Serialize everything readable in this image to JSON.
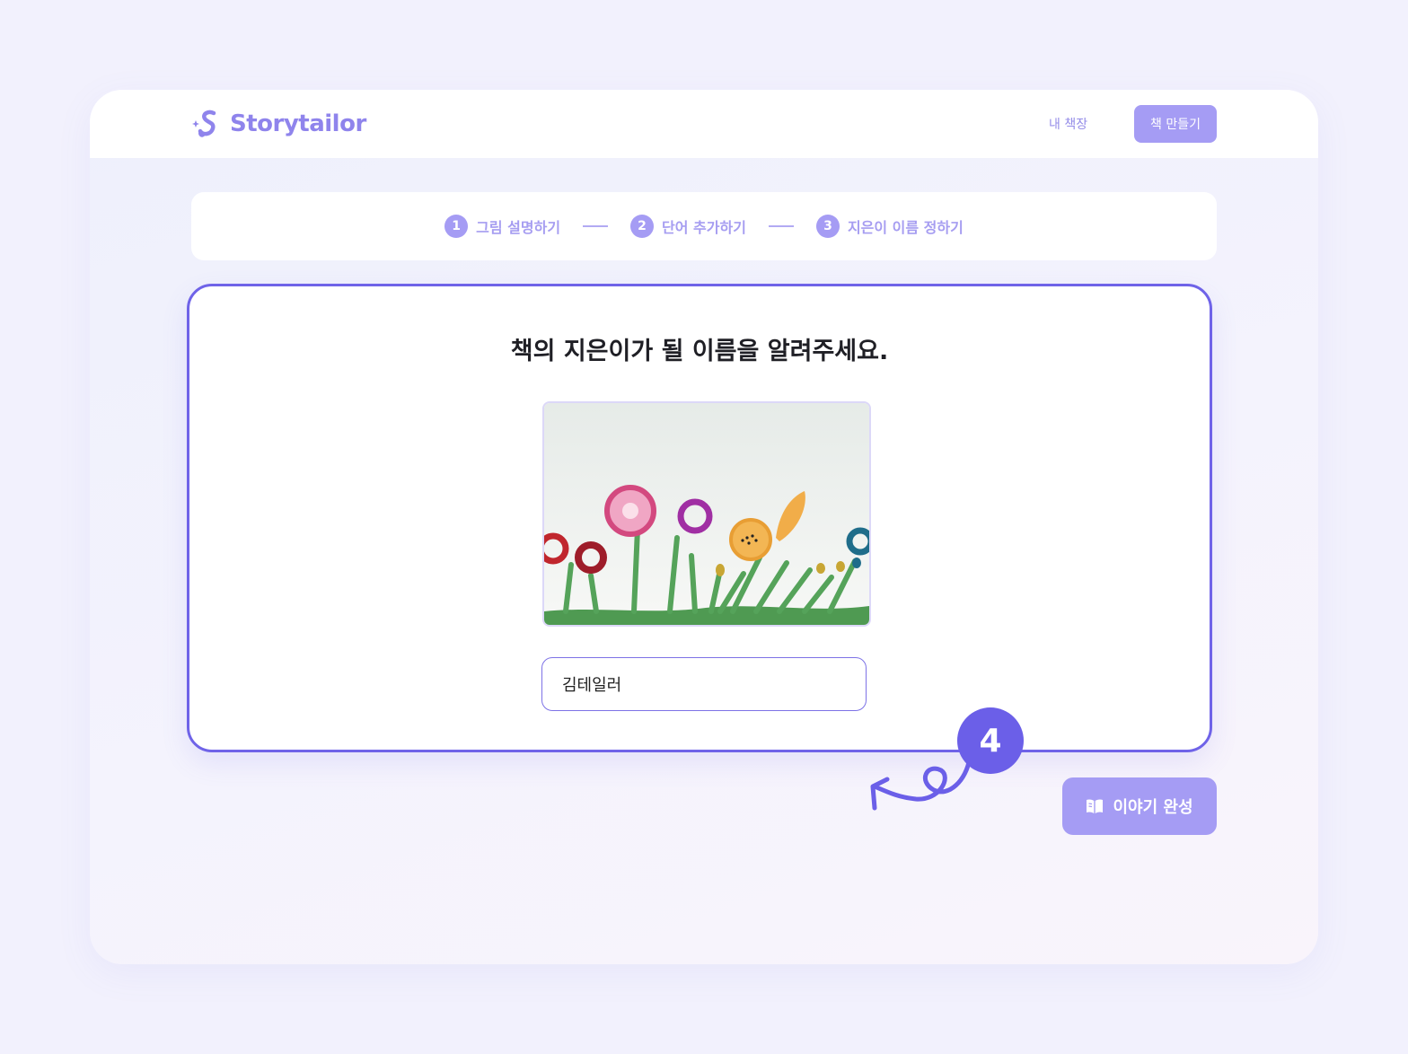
{
  "navbar": {
    "logo_text": "Storytailor",
    "my_shelf_label": "내 책장",
    "create_book_label": "책 만들기"
  },
  "steps": [
    {
      "number": "1",
      "label": "그림 설명하기"
    },
    {
      "number": "2",
      "label": "단어 추가하기"
    },
    {
      "number": "3",
      "label": "지은이 이름 정하기"
    }
  ],
  "main": {
    "title": "책의 지은이가 될 이름을 알려주세요.",
    "author_input_value": "김테일러",
    "complete_button_label": "이야기 완성"
  },
  "annotation": {
    "badge_number": "4"
  },
  "icons": {
    "logo": "sparkle-s-logo-icon",
    "complete": "open-book-icon",
    "arrow": "curly-arrow-icon"
  },
  "colors": {
    "accent": "#6f63e8",
    "accent_soft": "#a59cf4",
    "badge": "#6b5fe8",
    "title_text": "#1f1f25"
  }
}
